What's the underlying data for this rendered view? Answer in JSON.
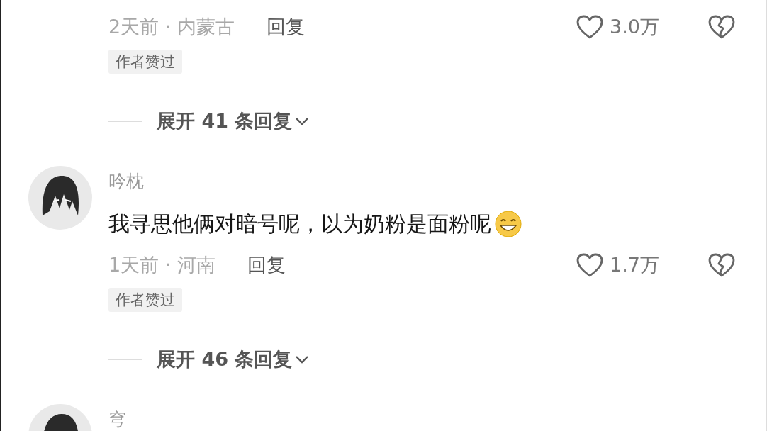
{
  "comments": [
    {
      "meta": "2天前 · 内蒙古",
      "reply": "回复",
      "likes": "3.0万",
      "liked": false,
      "tag": "作者赞过",
      "expand": "展开 41 条回复"
    },
    {
      "name": "吟枕",
      "text": "我寻思他俩对暗号呢，以为奶粉是面粉呢",
      "meta": "1天前 · 河南",
      "reply": "回复",
      "likes": "1.7万",
      "liked": false,
      "tag": "作者赞过",
      "expand": "展开 46 条回复"
    },
    {
      "name": "穹"
    }
  ]
}
